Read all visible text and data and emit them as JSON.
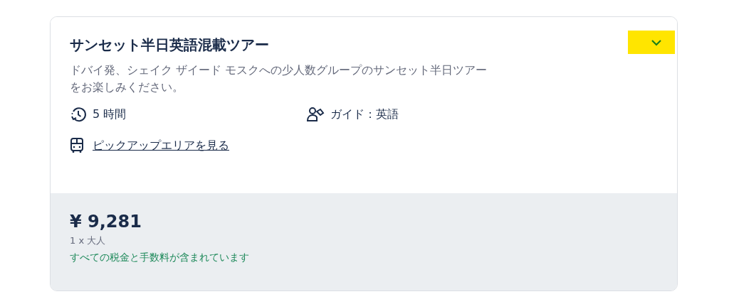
{
  "card": {
    "title": "サンセット半日英語混載ツアー",
    "expanded": false,
    "description": "ドバイ発、シェイク ザイード モスクへの少人数グループのサンセット半日ツアーをお楽しみください。",
    "features": [
      {
        "kind": "duration",
        "text": "5 時間"
      },
      {
        "kind": "guide",
        "text": "ガイド：英語"
      }
    ],
    "pickup_link": "ピックアップエリアを見る",
    "price": {
      "amount": "¥ 9,281",
      "quantity": "1 x 大人",
      "note": "すべての税金と手数料が含まれています"
    }
  }
}
